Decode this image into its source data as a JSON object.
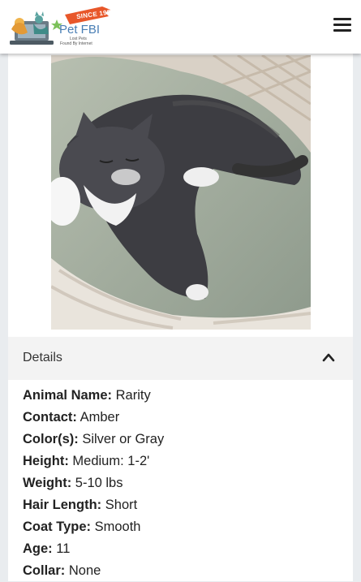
{
  "header": {
    "logo": {
      "banner_text": "SINCE 1998",
      "brand_name": "Pet FBI",
      "tagline_line1": "Lost Pets",
      "tagline_line2": "Found By Internet"
    },
    "menu_icon": "hamburger-menu-icon"
  },
  "photo": {
    "subject": "gray and white cat sleeping on a green fuzzy blanket in a woven basket"
  },
  "details": {
    "title": "Details",
    "toggle_icon": "chevron-up-icon",
    "fields": [
      {
        "label": "Animal Name:",
        "value": "Rarity"
      },
      {
        "label": "Contact:",
        "value": "Amber"
      },
      {
        "label": "Color(s):",
        "value": "Silver or Gray"
      },
      {
        "label": "Height:",
        "value": "Medium: 1-2'"
      },
      {
        "label": "Weight:",
        "value": "5-10 lbs"
      },
      {
        "label": "Hair Length:",
        "value": "Short"
      },
      {
        "label": "Coat Type:",
        "value": "Smooth"
      },
      {
        "label": "Age:",
        "value": "11"
      },
      {
        "label": "Collar:",
        "value": "None"
      }
    ]
  },
  "colors": {
    "brand_blue": "#4a7fb5",
    "banner_orange": "#e8572a",
    "page_bg": "#e9ecef",
    "details_header_bg": "#f3f3f3"
  }
}
